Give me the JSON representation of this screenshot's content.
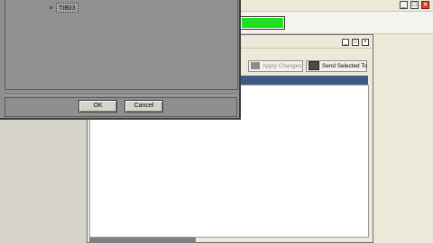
{
  "colors": {
    "progress": "#1fe01f",
    "header_band": "#3b5a86",
    "close_button": "#e0412a"
  },
  "main_window": {
    "caption_buttons": {
      "minimize": "_",
      "maximize": "□",
      "close": "×"
    }
  },
  "progress": {
    "fraction": 1.0
  },
  "sub_window": {
    "caption_buttons": {
      "minimize": "_",
      "maximize": "□",
      "close": "×"
    },
    "toolbar": {
      "apply_label": "Apply Changes",
      "apply_icon": "disabled-apply-icon",
      "send_label": "Send Selected To",
      "send_icon": "computer-icon"
    }
  },
  "dialog": {
    "tree_node_label": "TIB03",
    "ok_label": "OK",
    "cancel_label": "Cancel"
  }
}
